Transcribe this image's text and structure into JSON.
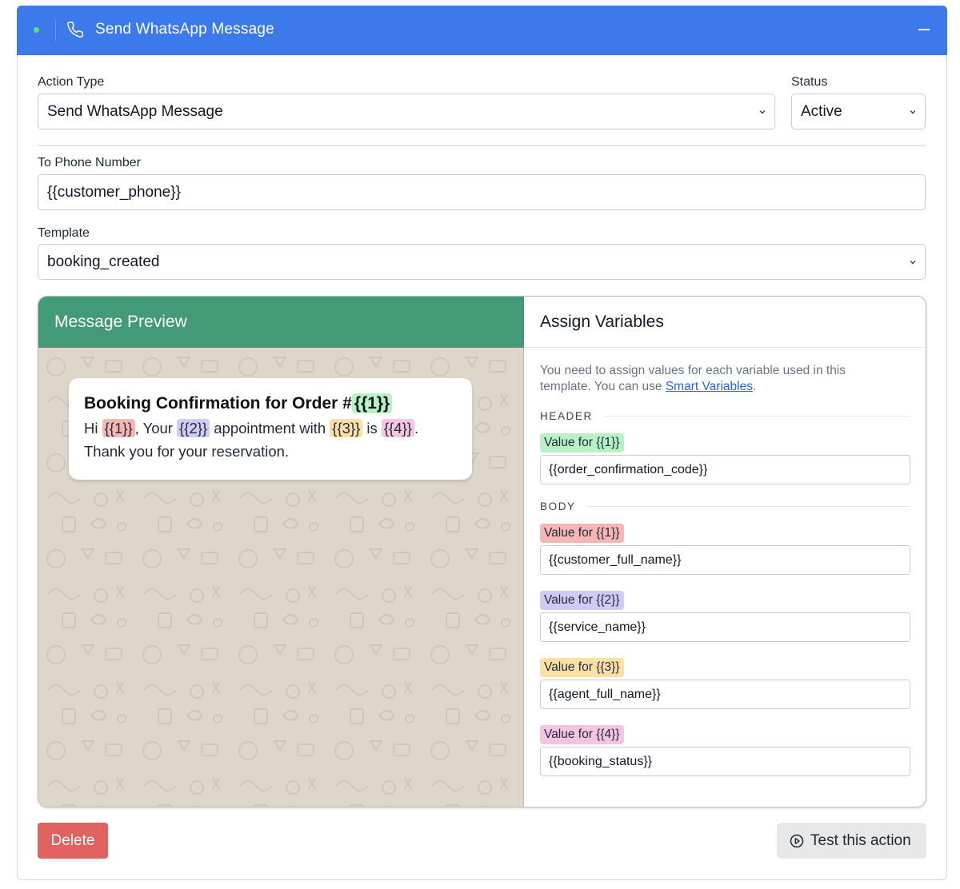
{
  "header": {
    "title": "Send WhatsApp Message",
    "icons": [
      "status-dot",
      "phone-icon",
      "minimize-icon"
    ]
  },
  "action_type": {
    "label": "Action Type",
    "value": "Send WhatsApp Message"
  },
  "status": {
    "label": "Status",
    "value": "Active"
  },
  "to_phone": {
    "label": "To Phone Number",
    "value": "{{customer_phone}}"
  },
  "template": {
    "label": "Template",
    "value": "booking_created"
  },
  "preview": {
    "title": "Message Preview",
    "heading_text": "Booking Confirmation for Order #",
    "heading_var": "{{1}}",
    "body": {
      "p1": "Hi ",
      "v1": "{{1}}",
      "p2": ", Your ",
      "v2": "{{2}}",
      "p3": " appointment with ",
      "v3": "{{3}}",
      "p4": " is ",
      "v4": "{{4}}",
      "p5": ".",
      "line2": "Thank you for your reservation."
    }
  },
  "assign": {
    "title": "Assign Variables",
    "intro_text": "You need to assign values for each variable used in this template. You can use ",
    "intro_link": "Smart Variables",
    "intro_end": ".",
    "header_section": "HEADER",
    "body_section": "BODY",
    "header_vars": [
      {
        "label": "Value for {{1}}",
        "value": "{{order_confirmation_code}}",
        "color": "#b7f2c7"
      }
    ],
    "body_vars": [
      {
        "label": "Value for {{1}}",
        "value": "{{customer_full_name}}",
        "color": "#f6b6b4"
      },
      {
        "label": "Value for {{2}}",
        "value": "{{service_name}}",
        "color": "#cfcaf6"
      },
      {
        "label": "Value for {{3}}",
        "value": "{{agent_full_name}}",
        "color": "#fbe0a6"
      },
      {
        "label": "Value for {{4}}",
        "value": "{{booking_status}}",
        "color": "#f6c4e2"
      }
    ]
  },
  "buttons": {
    "delete": "Delete",
    "test": "Test this action"
  },
  "colors": {
    "header_bg": "#3c7aec",
    "preview_header": "#429a77",
    "wallpaper": "#ded6c9",
    "delete": "#e0625f",
    "link": "#2563eb"
  }
}
